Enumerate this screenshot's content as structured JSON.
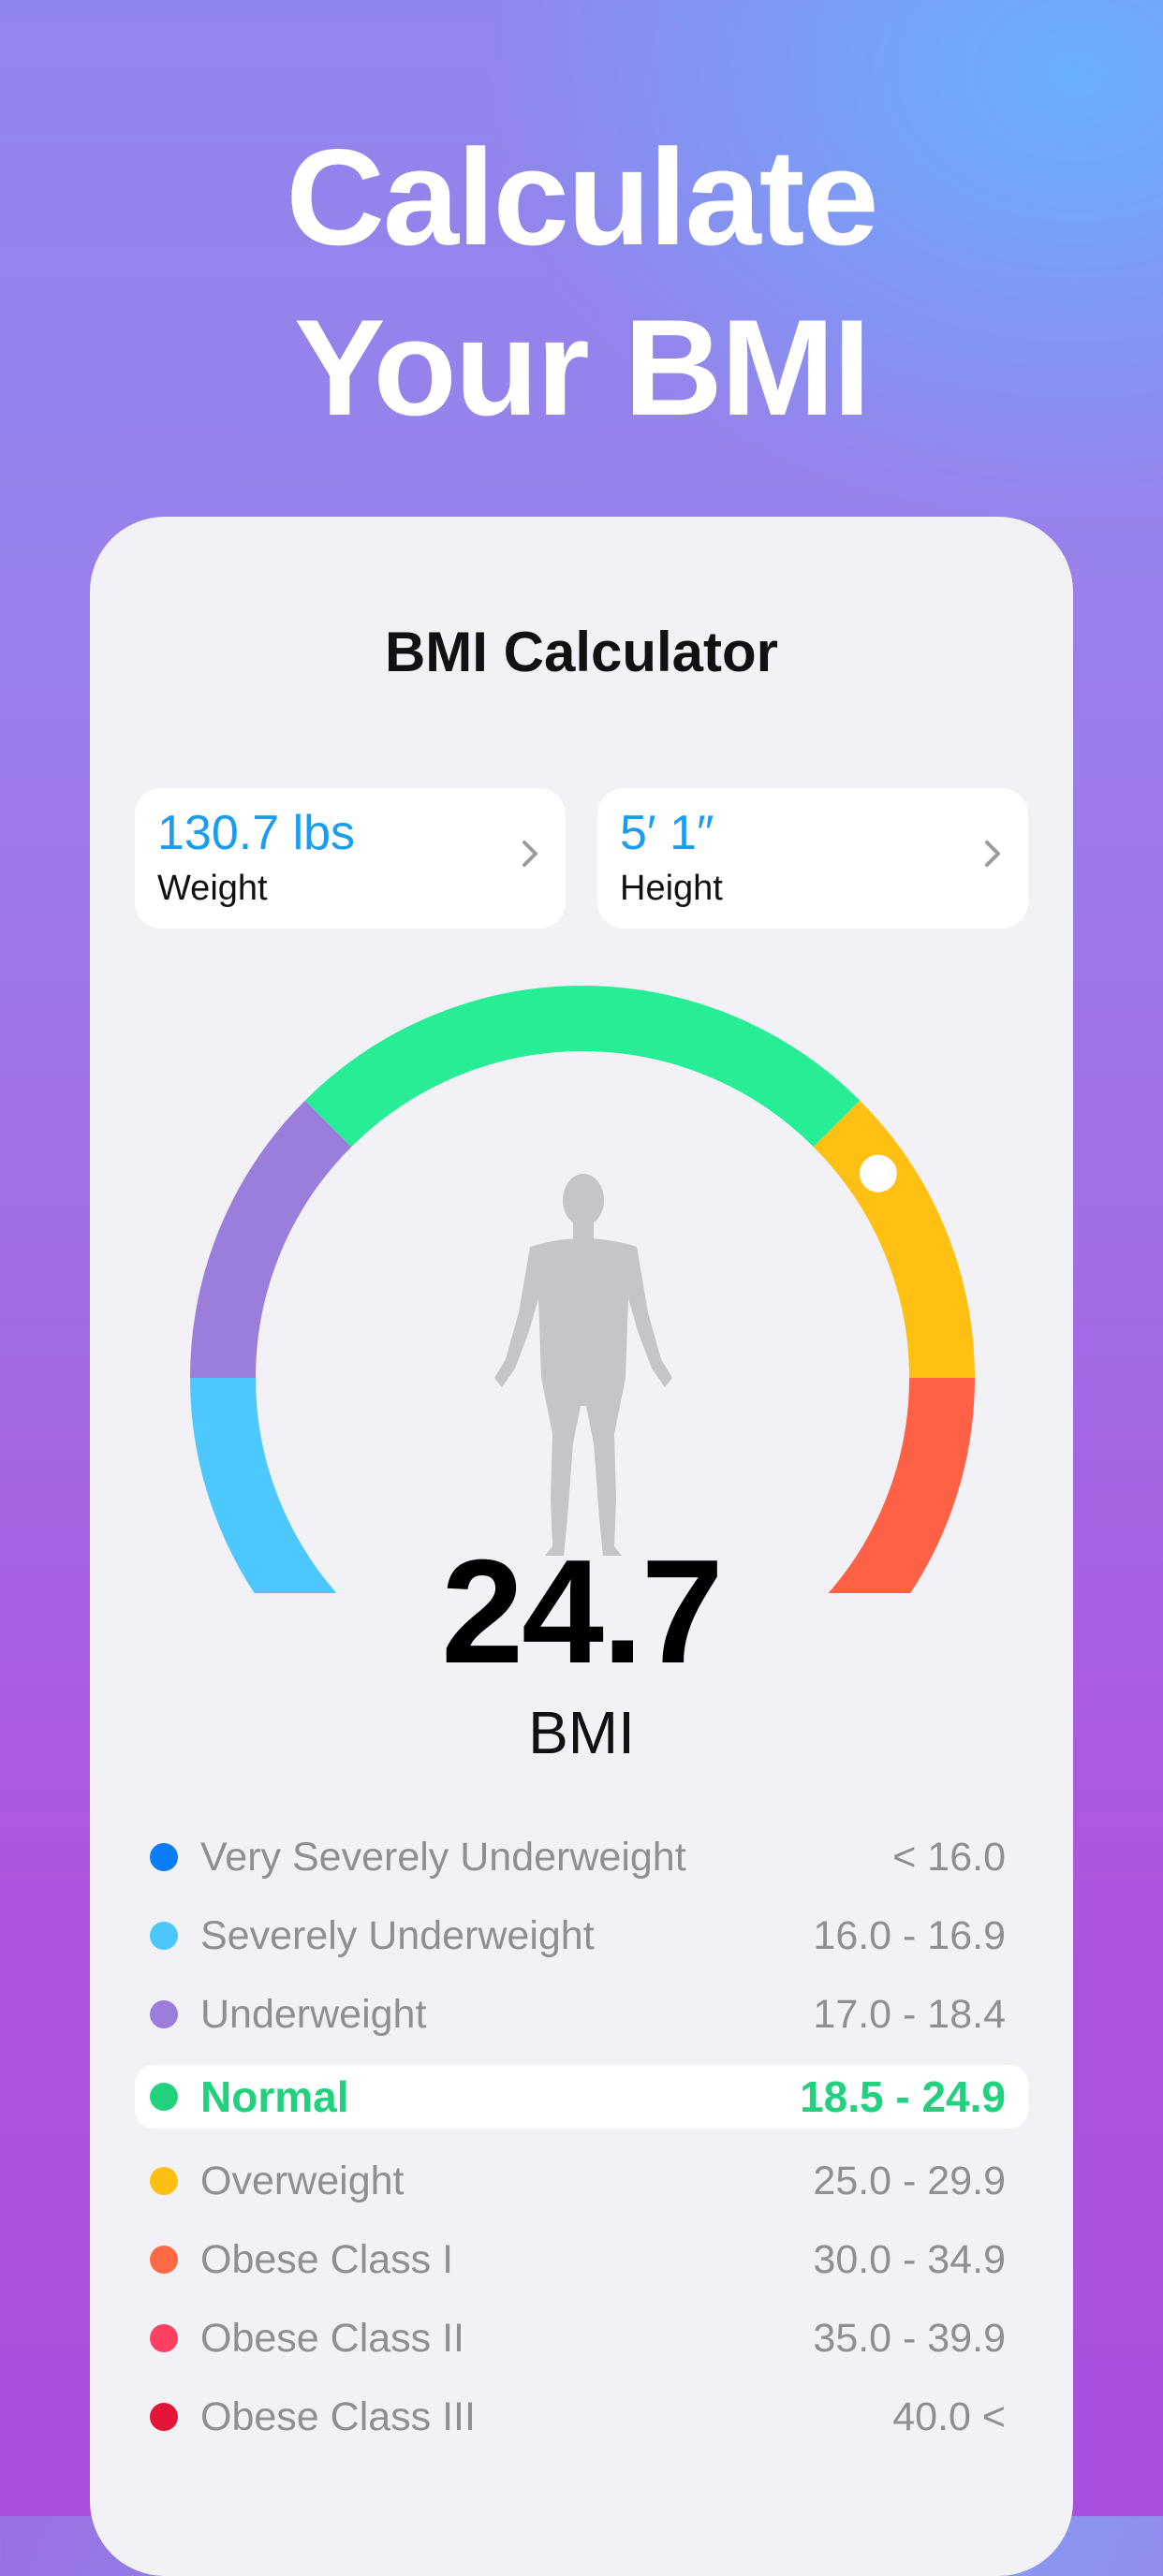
{
  "headline": {
    "line1": "Calculate",
    "line2": "Your BMI"
  },
  "card": {
    "title": "BMI Calculator",
    "weight": {
      "value": "130.7 lbs",
      "label": "Weight"
    },
    "height": {
      "value": "5′ 1″",
      "label": "Height"
    },
    "bmi_value": "24.7",
    "bmi_label": "BMI",
    "gauge_colors": {
      "severely_underweight": "#4dc8fe",
      "underweight": "#9b7edb",
      "normal": "#27ee96",
      "overweight": "#ffc014",
      "obese": "#ff6147"
    },
    "indicator_position": 0.705,
    "categories": [
      {
        "name": "Very Severely Underweight",
        "range": "< 16.0",
        "color": "#0a7cf5",
        "active": false
      },
      {
        "name": "Severely Underweight",
        "range": "16.0 - 16.9",
        "color": "#4dc8fe",
        "active": false
      },
      {
        "name": "Underweight",
        "range": "17.0 - 18.4",
        "color": "#9b7edb",
        "active": false
      },
      {
        "name": "Normal",
        "range": "18.5 - 24.9",
        "color": "#21d17d",
        "active": true
      },
      {
        "name": "Overweight",
        "range": "25.0 - 29.9",
        "color": "#ffc014",
        "active": false
      },
      {
        "name": "Obese Class I",
        "range": "30.0 - 34.9",
        "color": "#ff6a45",
        "active": false
      },
      {
        "name": "Obese Class II",
        "range": "35.0 - 39.9",
        "color": "#ff4062",
        "active": false
      },
      {
        "name": "Obese Class III",
        "range": "40.0 <",
        "color": "#e3163a",
        "active": false
      }
    ]
  }
}
